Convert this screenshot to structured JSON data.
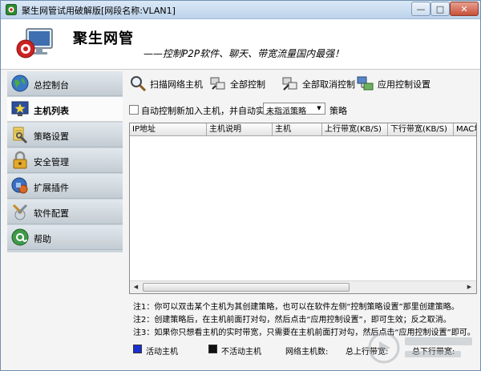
{
  "window": {
    "title": "聚生网管试用破解版[网段名称:VLAN1]",
    "minimize_label": "—",
    "maximize_label": "□",
    "close_label": "✕"
  },
  "header": {
    "brand": "聚生网管",
    "slogan": "——控制P2P软件、聊天、带宽流量国内最强！"
  },
  "sidebar": {
    "items": [
      {
        "label": "总控制台",
        "icon": "globe-icon",
        "active": false
      },
      {
        "label": "主机列表",
        "icon": "star-screen-icon",
        "active": true
      },
      {
        "label": "策略设置",
        "icon": "wrench-icon",
        "active": false
      },
      {
        "label": "安全管理",
        "icon": "lock-icon",
        "active": false
      },
      {
        "label": "扩展插件",
        "icon": "puzzle-icon",
        "active": false
      },
      {
        "label": "软件配置",
        "icon": "tools-icon",
        "active": false
      },
      {
        "label": "帮助",
        "icon": "help-icon",
        "active": false
      }
    ]
  },
  "toolbar": {
    "scan_label": "扫描网络主机",
    "control_all_label": "全部控制",
    "cancel_all_label": "全部取消控制",
    "apply_label": "应用控制设置"
  },
  "options": {
    "auto_control_label": "自动控制新加入主机，并自动实施",
    "auto_control_checked": false,
    "strategy_selected": "未指派策略",
    "strategy_suffix": "策略"
  },
  "table": {
    "columns": [
      "IP地址",
      "主机说明",
      "主机",
      "上行带宽(KB/S)",
      "下行带宽(KB/S)",
      "MAC地"
    ],
    "rows": []
  },
  "notes": [
    "注1：你可以双击某个主机为其创建策略，也可以在软件左侧“控制策略设置”那里创建策略。",
    "注2：创建策略后，在主机前面打对勾，然后点击“应用控制设置”，即可生效；反之取消。",
    "注3：如果你只想看主机的实时带宽，只需要在主机前面打对勾，然后点击“应用控制设置”即可。"
  ],
  "legend": {
    "active_label": "活动主机",
    "inactive_label": "不活动主机",
    "bandwidth_label": "网络主机数:",
    "up_label": "总上行带宽:",
    "down_label": "总下行带宽:",
    "active_color": "#1a2fd0",
    "inactive_color": "#111111"
  },
  "colors": {
    "titlebar": "#c9dcef",
    "sidebar": "#cbd5dc",
    "accent_red": "#cc2222"
  }
}
